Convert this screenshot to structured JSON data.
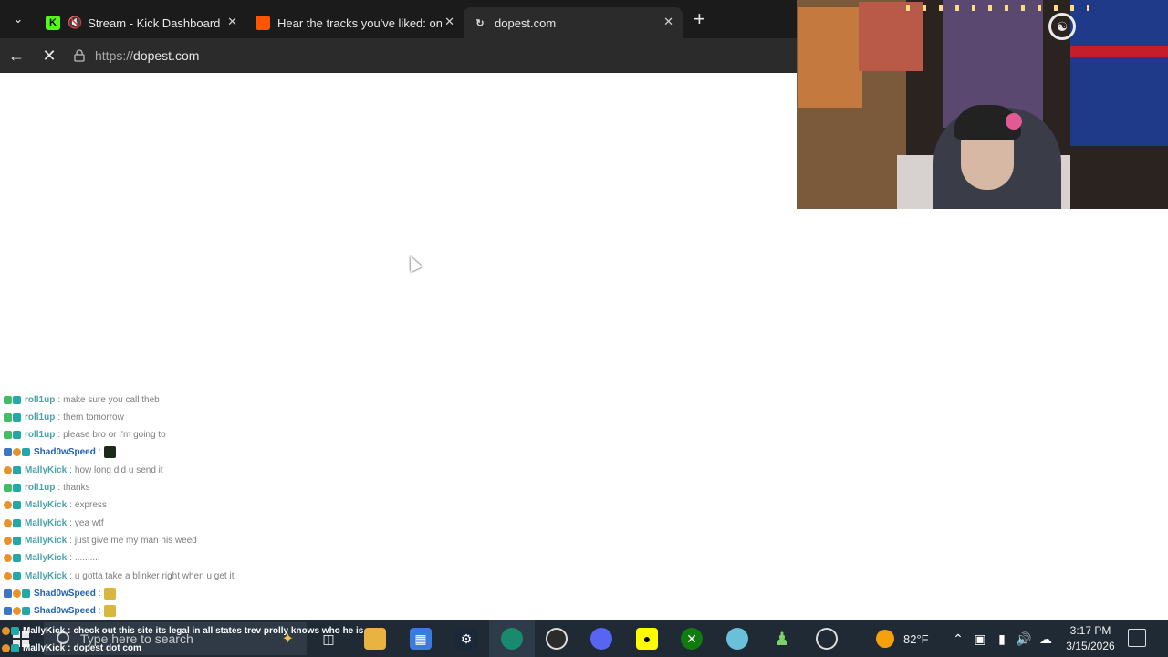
{
  "browser": {
    "tabs": [
      {
        "label": "Stream - Kick Dashboard",
        "icon": "kick-icon",
        "active": false
      },
      {
        "label": "Hear the tracks you've liked: on So",
        "icon": "soundcloud-icon",
        "active": false
      },
      {
        "label": "dopest.com",
        "icon": "loading-icon",
        "active": true
      }
    ],
    "url_prefix": "https://",
    "url_host": "dopest.com"
  },
  "chat": {
    "rows": [
      {
        "badges": [
          "green",
          "teal"
        ],
        "user": "roll1up",
        "msg": "make sure you call theb",
        "emote": null
      },
      {
        "badges": [
          "green",
          "teal"
        ],
        "user": "roll1up",
        "msg": "them tomorrow",
        "emote": null
      },
      {
        "badges": [
          "green",
          "teal"
        ],
        "user": "roll1up",
        "msg": "please bro or I'm going to",
        "emote": null
      },
      {
        "badges": [
          "blue",
          "orange",
          "teal"
        ],
        "user": "Shad0wSpeed",
        "msg": "",
        "emote": "dark",
        "highlight": true
      },
      {
        "badges": [
          "orange",
          "teal"
        ],
        "user": "MallyKick",
        "msg": "how long did u send it",
        "emote": null
      },
      {
        "badges": [
          "green",
          "teal"
        ],
        "user": "roll1up",
        "msg": "thanks",
        "emote": null
      },
      {
        "badges": [
          "orange",
          "teal"
        ],
        "user": "MallyKick",
        "msg": "express",
        "emote": null
      },
      {
        "badges": [
          "orange",
          "teal"
        ],
        "user": "MallyKick",
        "msg": "yea wtf",
        "emote": null
      },
      {
        "badges": [
          "orange",
          "teal"
        ],
        "user": "MallyKick",
        "msg": "just give me my man his weed",
        "emote": null
      },
      {
        "badges": [
          "orange",
          "teal"
        ],
        "user": "MallyKick",
        "msg": "..........",
        "emote": null
      },
      {
        "badges": [
          "orange",
          "teal"
        ],
        "user": "MallyKick",
        "msg": "u gotta take a blinker right when u get it",
        "emote": null
      },
      {
        "badges": [
          "blue",
          "orange",
          "teal"
        ],
        "user": "Shad0wSpeed",
        "msg": "",
        "emote": "yellow",
        "highlight": true
      },
      {
        "badges": [
          "blue",
          "orange",
          "teal"
        ],
        "user": "Shad0wSpeed",
        "msg": "",
        "emote": "yellow",
        "highlight": true
      }
    ],
    "overlay": [
      {
        "user": "MallyKick",
        "msg": "check out this site its legal in all states trev prolly knows who he is"
      },
      {
        "user": "MallyKick",
        "msg": "dopest dot com"
      }
    ]
  },
  "taskbar": {
    "search_placeholder": "Type here to search",
    "weather": "82°F",
    "time": "3:17 PM",
    "date": "3/15/2026"
  },
  "colors": {
    "tabbar": "#1b1b1b",
    "addressbar": "#2b2b2b",
    "taskbar": "#1f2a35",
    "chat_user": "#4aa4a7",
    "chat_user_highlight": "#1d61b3"
  }
}
